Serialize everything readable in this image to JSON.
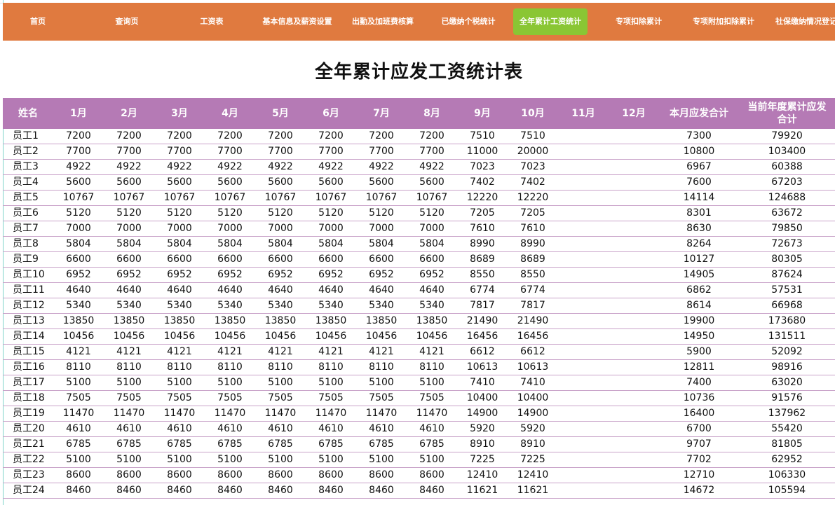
{
  "nav": {
    "items": [
      {
        "label": "首页"
      },
      {
        "label": "查询页"
      },
      {
        "label": "工资表"
      },
      {
        "label": "基本信息及薪资设置"
      },
      {
        "label": "出勤及加班费核算"
      },
      {
        "label": "已缴纳个税统计"
      },
      {
        "label": "全年累计工资统计"
      },
      {
        "label": "专项扣除累计"
      },
      {
        "label": "专项附加扣除累计"
      },
      {
        "label": "社保缴纳情况登记"
      }
    ],
    "active_index": 6,
    "bg_color": "#e07a3f",
    "active_color": "#8ac634"
  },
  "page": {
    "title": "全年累计应发工资统计表"
  },
  "table": {
    "header_color": "#b57ab5",
    "headers": [
      "姓名",
      "1月",
      "2月",
      "3月",
      "4月",
      "5月",
      "6月",
      "7月",
      "8月",
      "9月",
      "10月",
      "11月",
      "12月",
      "本月应发合计",
      "当前年度累计应发合计"
    ],
    "rows": [
      [
        "员工1",
        "7200",
        "7200",
        "7200",
        "7200",
        "7200",
        "7200",
        "7200",
        "7200",
        "7510",
        "7510",
        "",
        "",
        "7300",
        "79920"
      ],
      [
        "员工2",
        "7700",
        "7700",
        "7700",
        "7700",
        "7700",
        "7700",
        "7700",
        "7700",
        "11000",
        "20000",
        "",
        "",
        "10800",
        "103400"
      ],
      [
        "员工3",
        "4922",
        "4922",
        "4922",
        "4922",
        "4922",
        "4922",
        "4922",
        "4922",
        "7023",
        "7023",
        "",
        "",
        "6967",
        "60388"
      ],
      [
        "员工4",
        "5600",
        "5600",
        "5600",
        "5600",
        "5600",
        "5600",
        "5600",
        "5600",
        "7402",
        "7402",
        "",
        "",
        "7600",
        "67203"
      ],
      [
        "员工5",
        "10767",
        "10767",
        "10767",
        "10767",
        "10767",
        "10767",
        "10767",
        "10767",
        "12220",
        "12220",
        "",
        "",
        "14114",
        "124688"
      ],
      [
        "员工6",
        "5120",
        "5120",
        "5120",
        "5120",
        "5120",
        "5120",
        "5120",
        "5120",
        "7205",
        "7205",
        "",
        "",
        "8301",
        "63672"
      ],
      [
        "员工7",
        "7000",
        "7000",
        "7000",
        "7000",
        "7000",
        "7000",
        "7000",
        "7000",
        "7610",
        "7610",
        "",
        "",
        "8630",
        "79850"
      ],
      [
        "员工8",
        "5804",
        "5804",
        "5804",
        "5804",
        "5804",
        "5804",
        "5804",
        "5804",
        "8990",
        "8990",
        "",
        "",
        "8264",
        "72673"
      ],
      [
        "员工9",
        "6600",
        "6600",
        "6600",
        "6600",
        "6600",
        "6600",
        "6600",
        "6600",
        "8689",
        "8689",
        "",
        "",
        "10127",
        "80305"
      ],
      [
        "员工10",
        "6952",
        "6952",
        "6952",
        "6952",
        "6952",
        "6952",
        "6952",
        "6952",
        "8550",
        "8550",
        "",
        "",
        "14905",
        "87624"
      ],
      [
        "员工11",
        "4640",
        "4640",
        "4640",
        "4640",
        "4640",
        "4640",
        "4640",
        "4640",
        "6774",
        "6774",
        "",
        "",
        "6862",
        "57531"
      ],
      [
        "员工12",
        "5340",
        "5340",
        "5340",
        "5340",
        "5340",
        "5340",
        "5340",
        "5340",
        "7817",
        "7817",
        "",
        "",
        "8614",
        "66968"
      ],
      [
        "员工13",
        "13850",
        "13850",
        "13850",
        "13850",
        "13850",
        "13850",
        "13850",
        "13850",
        "21490",
        "21490",
        "",
        "",
        "19900",
        "173680"
      ],
      [
        "员工14",
        "10456",
        "10456",
        "10456",
        "10456",
        "10456",
        "10456",
        "10456",
        "10456",
        "16456",
        "16456",
        "",
        "",
        "14950",
        "131511"
      ],
      [
        "员工15",
        "4121",
        "4121",
        "4121",
        "4121",
        "4121",
        "4121",
        "4121",
        "4121",
        "6612",
        "6612",
        "",
        "",
        "5900",
        "52092"
      ],
      [
        "员工16",
        "8110",
        "8110",
        "8110",
        "8110",
        "8110",
        "8110",
        "8110",
        "8110",
        "10613",
        "10613",
        "",
        "",
        "12811",
        "98916"
      ],
      [
        "员工17",
        "5100",
        "5100",
        "5100",
        "5100",
        "5100",
        "5100",
        "5100",
        "5100",
        "7410",
        "7410",
        "",
        "",
        "7400",
        "63020"
      ],
      [
        "员工18",
        "7505",
        "7505",
        "7505",
        "7505",
        "7505",
        "7505",
        "7505",
        "7505",
        "10400",
        "10400",
        "",
        "",
        "10736",
        "91576"
      ],
      [
        "员工19",
        "11470",
        "11470",
        "11470",
        "11470",
        "11470",
        "11470",
        "11470",
        "11470",
        "14900",
        "14900",
        "",
        "",
        "16400",
        "137962"
      ],
      [
        "员工20",
        "4610",
        "4610",
        "4610",
        "4610",
        "4610",
        "4610",
        "4610",
        "4610",
        "5920",
        "5920",
        "",
        "",
        "6700",
        "55420"
      ],
      [
        "员工21",
        "6785",
        "6785",
        "6785",
        "6785",
        "6785",
        "6785",
        "6785",
        "6785",
        "8910",
        "8910",
        "",
        "",
        "9707",
        "81805"
      ],
      [
        "员工22",
        "5100",
        "5100",
        "5100",
        "5100",
        "5100",
        "5100",
        "5100",
        "5100",
        "7225",
        "7225",
        "",
        "",
        "7702",
        "62952"
      ],
      [
        "员工23",
        "8600",
        "8600",
        "8600",
        "8600",
        "8600",
        "8600",
        "8600",
        "8600",
        "12410",
        "12410",
        "",
        "",
        "12710",
        "106330"
      ],
      [
        "员工24",
        "8460",
        "8460",
        "8460",
        "8460",
        "8460",
        "8460",
        "8460",
        "8460",
        "11621",
        "11621",
        "",
        "",
        "14672",
        "105594"
      ]
    ]
  }
}
